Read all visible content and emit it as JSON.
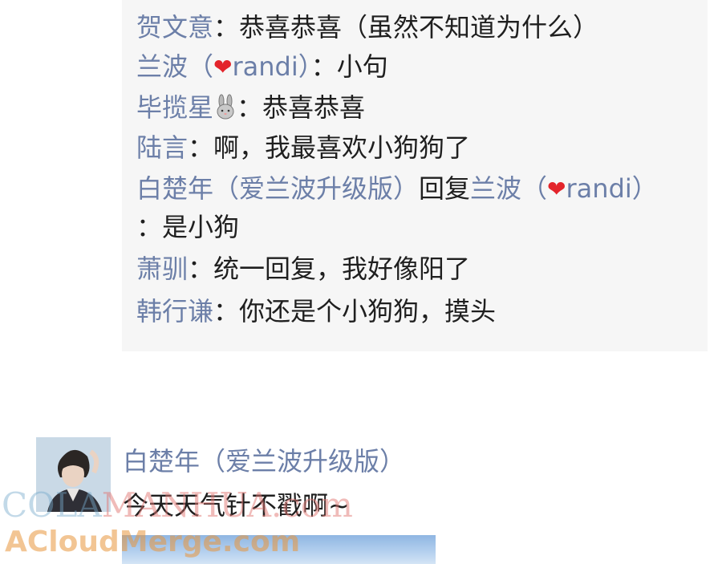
{
  "comments": [
    {
      "name": "贺文意",
      "sep": "：",
      "text": "恭喜恭喜（虽然不知道为什么）"
    },
    {
      "name_a": "兰波（",
      "heart": "❤",
      "name_b": "randi）",
      "sep": "：",
      "text": "小句"
    },
    {
      "name": "毕揽星",
      "sep": "：",
      "text": "恭喜恭喜"
    },
    {
      "name": "陆言",
      "sep": "：",
      "text": "啊，我最喜欢小狗狗了"
    },
    {
      "name": "白楚年（爱兰波升级版）",
      "reply_word": "回复",
      "target_a": "兰波（",
      "heart": "❤",
      "target_b": "randi）",
      "cont": "：是小狗"
    },
    {
      "name": "萧驯",
      "sep": "：",
      "text": "统一回复，我好像阳了"
    },
    {
      "name": "韩行谦",
      "sep": "：",
      "text": "你还是个小狗狗，摸头"
    }
  ],
  "post": {
    "author": "白楚年（爱兰波升级版）",
    "text": "今天天气针不戳啊~"
  },
  "watermarks": {
    "w1_a": "COLA",
    "w1_b": "MANHUA.com",
    "w2": "ACloudMerge.com"
  },
  "colors": {
    "name": "#6c7fa8",
    "text": "#1f1f1f",
    "heart": "#e3242b",
    "block_bg": "#f6f6f6"
  }
}
